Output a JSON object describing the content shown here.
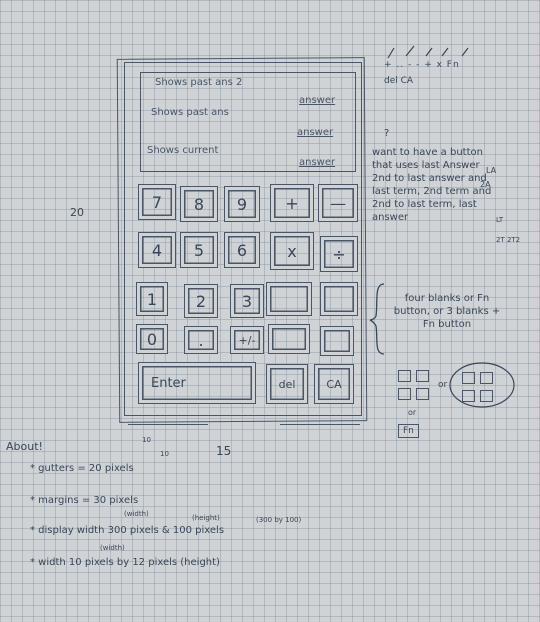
{
  "display": {
    "line1": "Shows past ans 2",
    "line2": "Shows past ans",
    "line3": "Shows current",
    "answer_label": "answer"
  },
  "keys": {
    "r1": [
      "7",
      "8",
      "9",
      "+",
      "—"
    ],
    "r2": [
      "4",
      "5",
      "6",
      "x",
      "÷"
    ],
    "r3": [
      "1",
      "2",
      "3",
      "",
      ""
    ],
    "r4": [
      "0",
      ".",
      "+/-",
      "",
      ""
    ],
    "enter": "Enter",
    "del": "del",
    "ca": "CA"
  },
  "top_symbols": {
    "line1": "+ .. - - + x Fn",
    "line2": "del CA"
  },
  "note_want": "want to have a button that uses last Answer 2nd to last answer and last term, 2nd term and 2nd to last term, last answer",
  "note_side": {
    "la": "LA",
    "twoa": "2A",
    "lt": "LT",
    "lt2": "2T 2T2",
    "q": "?"
  },
  "note_blanks": "four blanks or Fn button, or 3 blanks + Fn button",
  "fn_label": "Fn",
  "or_label": "or",
  "labels": {
    "twenty_left": "20",
    "fifteen": "15",
    "ten_a": "10",
    "ten_b": "10"
  },
  "about": {
    "title": "About!",
    "gutters": "* gutters = 20 pixels",
    "margins": "* margins = 30 pixels",
    "display": "* display width 300 pixels & 100 pixels",
    "display_width_tag": "(width)",
    "display_height_tag": "(height)",
    "display_size": "(300 by 100)",
    "width": "* width 10 pixels by 12 pixels (height)",
    "width_tag": "(width)"
  }
}
